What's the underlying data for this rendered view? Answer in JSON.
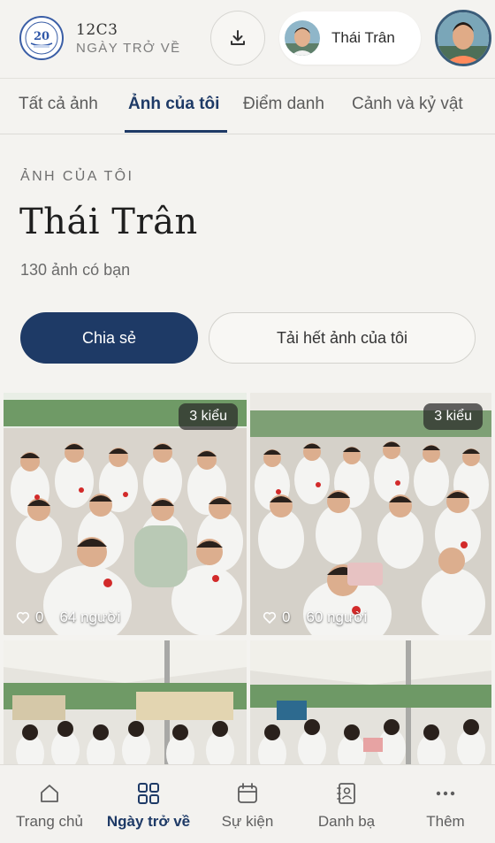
{
  "header": {
    "class_name": "12C3",
    "subtitle": "NGÀY TRỞ VỀ",
    "logo_text": "20",
    "user_chip_name": "Thái Trân"
  },
  "tabs": [
    {
      "label": "Tất cả ảnh"
    },
    {
      "label": "Ảnh của tôi"
    },
    {
      "label": "Điểm danh"
    },
    {
      "label": "Cảnh và kỷ vật"
    }
  ],
  "section": {
    "eyebrow": "ẢNH CỦA TÔI",
    "title": "Thái Trân",
    "count": "130 ảnh có bạn",
    "share_label": "Chia sẻ",
    "download_all_label": "Tải hết ảnh của tôi"
  },
  "photos": [
    {
      "badge": "3 kiểu",
      "likes": "0",
      "people": "64 người"
    },
    {
      "badge": "3 kiểu",
      "likes": "0",
      "people": "60 người"
    },
    {
      "badge": "",
      "likes": "",
      "people": ""
    },
    {
      "badge": "",
      "likes": "",
      "people": ""
    }
  ],
  "bottom_nav": [
    {
      "label": "Trang chủ",
      "icon": "home-icon"
    },
    {
      "label": "Ngày trở về",
      "icon": "grid-icon"
    },
    {
      "label": "Sự kiện",
      "icon": "calendar-icon"
    },
    {
      "label": "Danh bạ",
      "icon": "contacts-icon"
    },
    {
      "label": "Thêm",
      "icon": "more-icon"
    }
  ],
  "colors": {
    "accent": "#1e3a66",
    "background": "#f4f3f0"
  }
}
